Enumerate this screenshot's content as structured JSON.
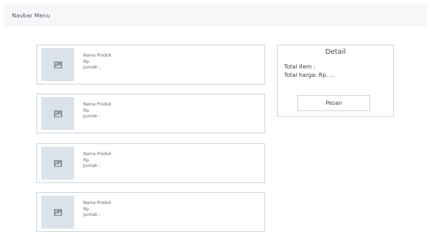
{
  "navbar": {
    "title": "Navbar Menu"
  },
  "products": [
    {
      "name": "Nama Produk",
      "price": "Rp.",
      "quantity": "Jumlah :",
      "icon": "image-placeholder-icon"
    },
    {
      "name": "Nama Produk",
      "price": "Rp.",
      "quantity": "Jumlah :",
      "icon": "image-placeholder-icon"
    },
    {
      "name": "Nama Produk",
      "price": "Rp.",
      "quantity": "Jumlah :",
      "icon": "image-placeholder-icon"
    },
    {
      "name": "Nama Produk",
      "price": "Rp.",
      "quantity": "Jumlah :",
      "icon": "image-placeholder-icon"
    }
  ],
  "detail": {
    "title": "Detail",
    "total_item": "Total item :",
    "total_price": "Total harga: Rp. ...",
    "order_button": "Pesan"
  },
  "colors": {
    "navbar_bg": "#f6f7f9",
    "border": "#c9d3dc",
    "placeholder_bg": "#dce2ea",
    "icon": "#8f9aa8"
  }
}
